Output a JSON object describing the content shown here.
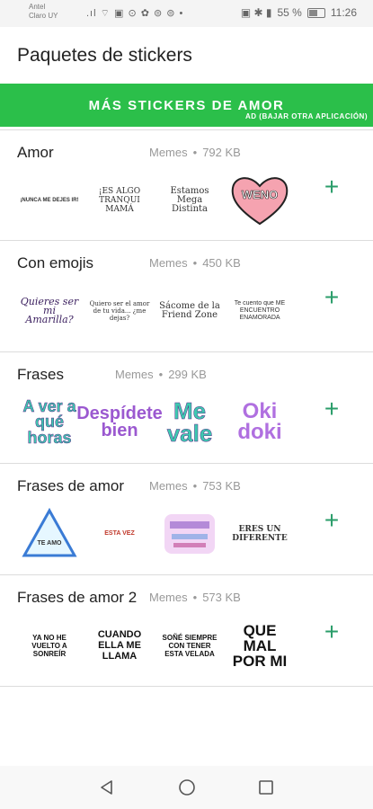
{
  "status": {
    "carrier1": "Antel",
    "carrier2": "Claro UY",
    "left_icons": ".ıl ⌔ ▣ ⊙ ✿ ⊜ ⊜ •",
    "right_icons": "▣ ✱ ▮",
    "battery_pct": "55 %",
    "battery_level": 0.55,
    "time": "11:26"
  },
  "app": {
    "title": "Paquetes de stickers"
  },
  "banner": {
    "main": "MÁS STICKERS DE AMOR",
    "ad": "AD (BAJAR OTRA APLICACIÓN)",
    "color": "#2bbf4a"
  },
  "accent_color": "#2a9d6a",
  "packs": [
    {
      "name": "Amor",
      "author": "Memes",
      "size": "792 KB",
      "stickers": [
        "¡NUNCA ME DEJES IR!",
        "¡ES ALGO TRANQUI MAMÁ",
        "Estamos Mega Distinta",
        "WENO"
      ]
    },
    {
      "name": "Con emojis",
      "author": "Memes",
      "size": "450 KB",
      "stickers": [
        "Quieres ser mi Amarilla?",
        "Quiero ser el amor de tu vida... ¿me dejas?",
        "Sácome de la Friend Zone",
        "Te cuento que ME ENCUENTRO ENAMORADA"
      ]
    },
    {
      "name": "Frases",
      "author": "Memes",
      "size": "299 KB",
      "stickers": [
        "A ver a qué horas",
        "Despídete bien",
        "Me vale",
        "Oki doki"
      ]
    },
    {
      "name": "Frases de amor",
      "author": "Memes",
      "size": "753 KB",
      "stickers": [
        "TE AMO",
        "ESTA VEZ",
        "",
        "ERES UN DIFERENTE"
      ]
    },
    {
      "name": "Frases de amor 2",
      "author": "Memes",
      "size": "573 KB",
      "stickers": [
        "YA NO HE VUELTO A SONREÍR",
        "CUANDO ELLA ME LLAMA",
        "SOÑÉ SIEMPRE CON TENER ESTA VELADA",
        "QUE MAL POR MI"
      ]
    }
  ],
  "add_label": "+",
  "dot": "•",
  "nav": {
    "back": "back-icon",
    "home": "home-icon",
    "recents": "recents-icon"
  }
}
